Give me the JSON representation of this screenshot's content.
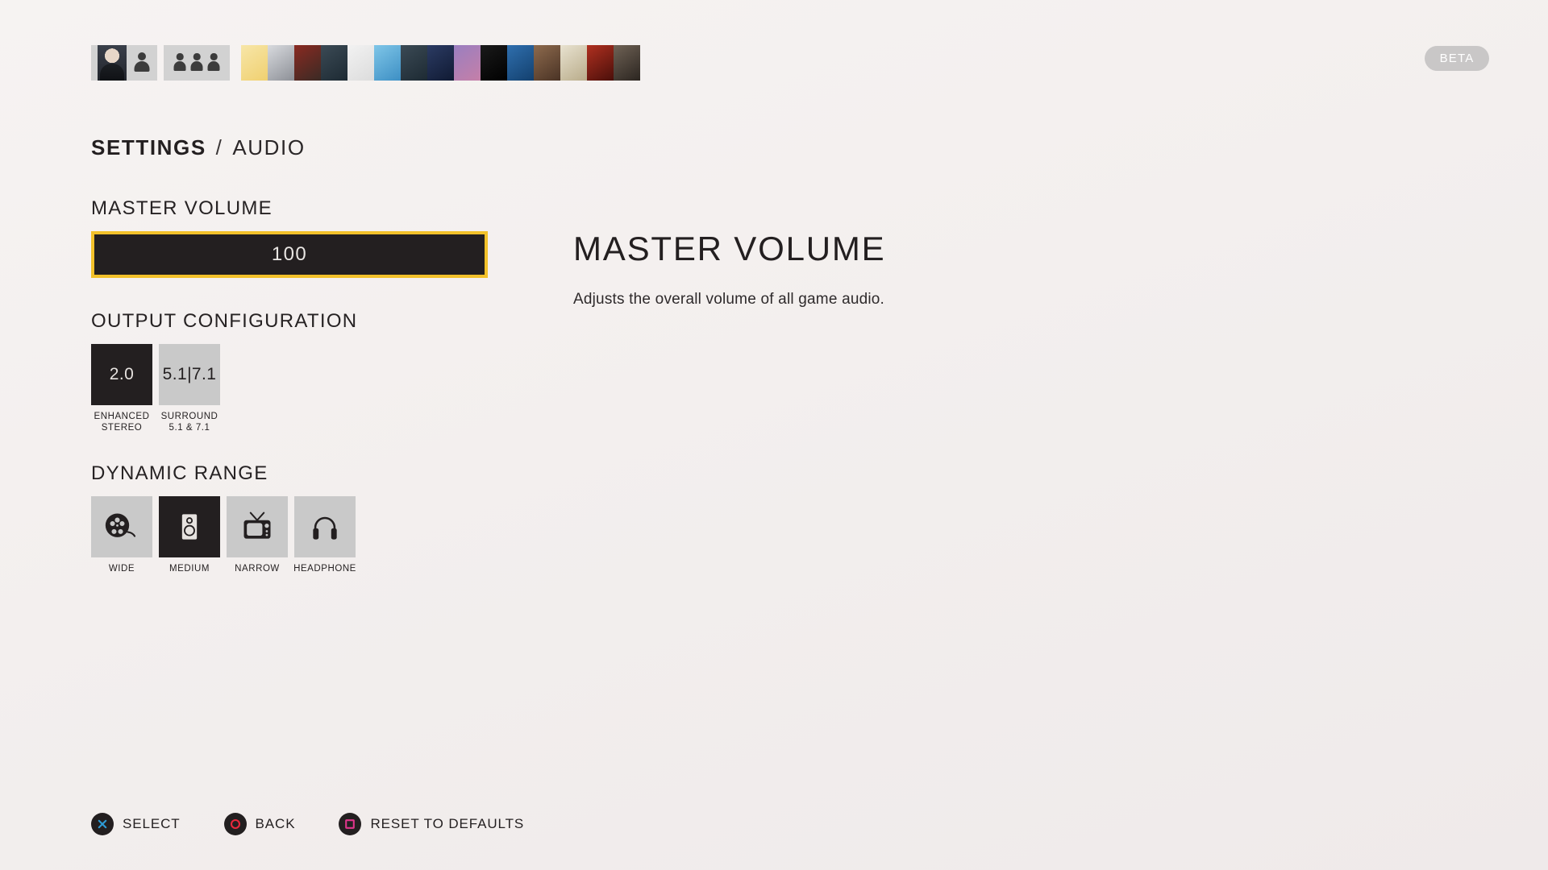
{
  "top_bar": {
    "profile_tile_name": "profile-selector",
    "group_tile_name": "party-selector",
    "beta_badge": "BETA",
    "avatars": [
      {
        "name": "tiger-face-avatar",
        "colors": [
          "#f7e6a8",
          "#f0d070"
        ]
      },
      {
        "name": "hooded-assassin-avatar",
        "colors": [
          "#d8dade",
          "#8d9097"
        ]
      },
      {
        "name": "red-beret-avatar",
        "colors": [
          "#8a2a22",
          "#3a2a24"
        ]
      },
      {
        "name": "camo-soldier-avatar",
        "colors": [
          "#3b4a55",
          "#1d2a33"
        ]
      },
      {
        "name": "penguin-avatar",
        "colors": [
          "#f2f2f2",
          "#dcdcdc"
        ]
      },
      {
        "name": "cartoon-kid-avatar",
        "colors": [
          "#7fc6e8",
          "#3d8fc4"
        ]
      },
      {
        "name": "camo-soldier-2-avatar",
        "colors": [
          "#3b4a55",
          "#1d2a33"
        ]
      },
      {
        "name": "anime-character-avatar",
        "colors": [
          "#2b3b63",
          "#101a33"
        ]
      },
      {
        "name": "purple-dragon-avatar",
        "colors": [
          "#9a7fc0",
          "#c57fa8"
        ]
      },
      {
        "name": "helmet-emblem-avatar",
        "colors": [
          "#1a1a1a",
          "#000000"
        ]
      },
      {
        "name": "raccoon-thief-avatar",
        "colors": [
          "#2f6fae",
          "#13406e"
        ]
      },
      {
        "name": "bearded-hero-avatar",
        "colors": [
          "#8d6a4d",
          "#4a3325"
        ]
      },
      {
        "name": "white-masked-avatar",
        "colors": [
          "#e8e2d0",
          "#b9ac8a"
        ]
      },
      {
        "name": "red-haired-avatar",
        "colors": [
          "#b03020",
          "#4a0f0a"
        ]
      },
      {
        "name": "male-portrait-avatar",
        "colors": [
          "#6f6255",
          "#2b2520"
        ]
      }
    ]
  },
  "breadcrumb": {
    "root": "SETTINGS",
    "separator": "/",
    "leaf": "AUDIO"
  },
  "sections": {
    "master_volume": {
      "heading": "MASTER VOLUME",
      "value": "100",
      "fill_percent": 100,
      "focused": true
    },
    "output_configuration": {
      "heading": "OUTPUT CONFIGURATION",
      "options": [
        {
          "tile_text": "2.0",
          "label": "ENHANCED\nSTEREO",
          "selected": true,
          "icon": "text-2-0"
        },
        {
          "tile_text": "5.1|7.1",
          "label": "SURROUND\n5.1 & 7.1",
          "selected": false,
          "icon": "text-51-71"
        }
      ]
    },
    "dynamic_range": {
      "heading": "DYNAMIC RANGE",
      "options": [
        {
          "label": "WIDE",
          "selected": false,
          "icon": "film-reel-icon"
        },
        {
          "label": "MEDIUM",
          "selected": true,
          "icon": "speaker-icon"
        },
        {
          "label": "NARROW",
          "selected": false,
          "icon": "television-icon"
        },
        {
          "label": "HEADPHONE",
          "selected": false,
          "icon": "headphones-icon"
        }
      ]
    }
  },
  "detail_panel": {
    "title": "MASTER VOLUME",
    "description": "Adjusts the overall volume of all game audio."
  },
  "action_bar": [
    {
      "label": "SELECT",
      "icon": "playstation-cross-icon",
      "color": "#2e9bd6"
    },
    {
      "label": "BACK",
      "icon": "playstation-circle-icon",
      "color": "#e8283c"
    },
    {
      "label": "RESET TO DEFAULTS",
      "icon": "playstation-square-icon",
      "color": "#e0358b"
    }
  ],
  "colors": {
    "background": "#f4f0f0",
    "ink": "#231f20",
    "focus_border": "#f2c12a",
    "tile_unselected": "#c9c9c9",
    "tile_selected": "#231f20",
    "beta_badge_bg": "#c9c7c7"
  }
}
